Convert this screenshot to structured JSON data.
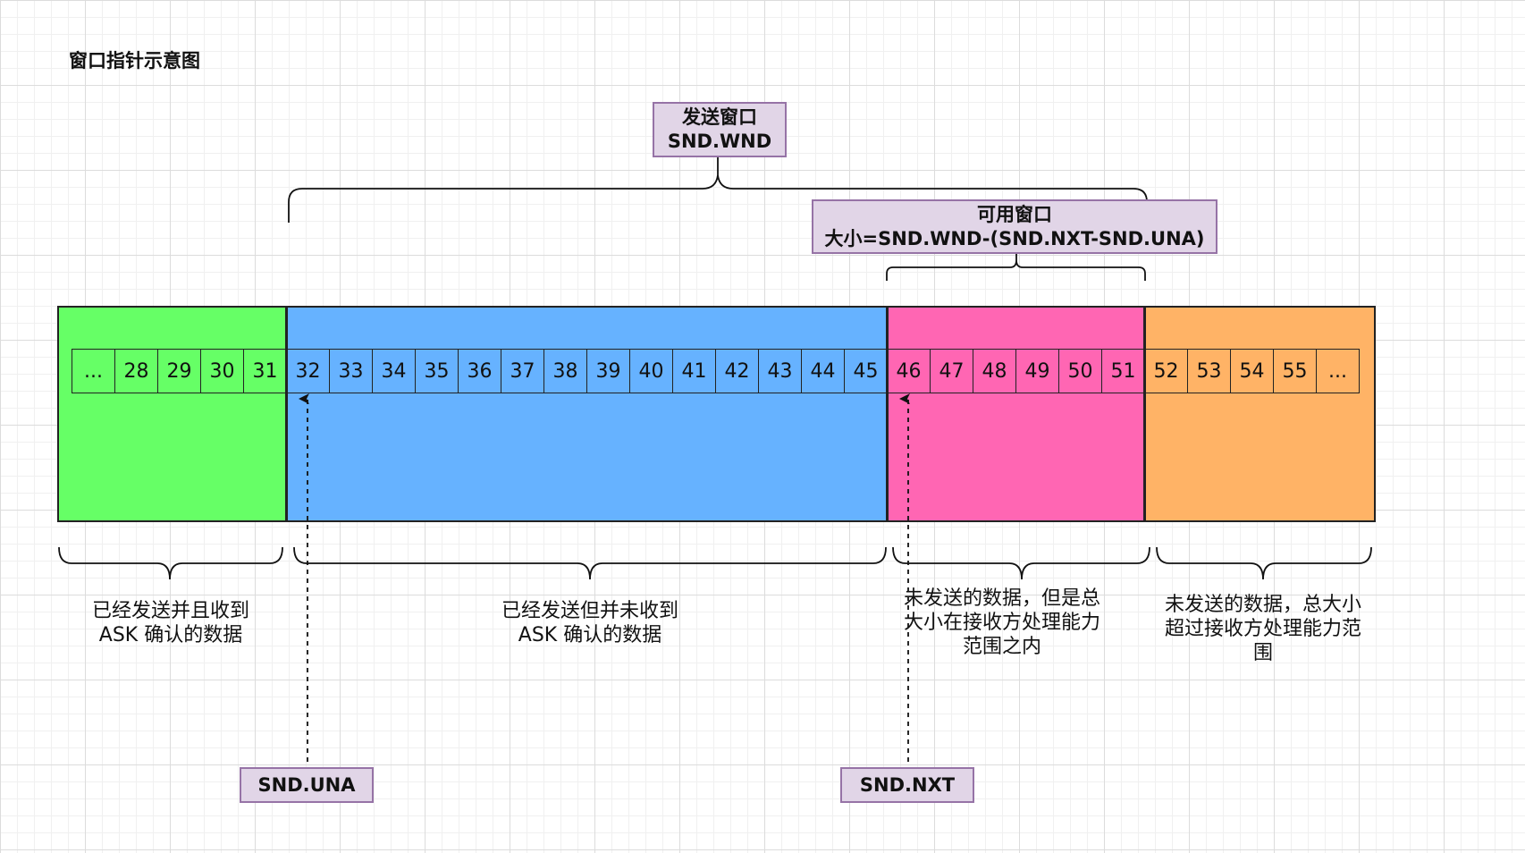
{
  "title": "窗口指针示意图",
  "send_window": {
    "line1": "发送窗口",
    "line2": "SND.WND"
  },
  "usable_window": {
    "line1": "可用窗口",
    "line2": "大小=SND.WND-(SND.NXT-SND.UNA)"
  },
  "cells": [
    "...",
    "28",
    "29",
    "30",
    "31",
    "32",
    "33",
    "34",
    "35",
    "36",
    "37",
    "38",
    "39",
    "40",
    "41",
    "42",
    "43",
    "44",
    "45",
    "46",
    "47",
    "48",
    "49",
    "50",
    "51",
    "52",
    "53",
    "54",
    "55",
    "..."
  ],
  "zones": [
    {
      "name": "acked",
      "color": "#66ff66",
      "from_cell": 0,
      "to_cell": 4
    },
    {
      "name": "sent-unacked",
      "color": "#66b2ff",
      "from_cell": 5,
      "to_cell": 18
    },
    {
      "name": "usable",
      "color": "#ff66b3",
      "from_cell": 19,
      "to_cell": 24
    },
    {
      "name": "outside-window",
      "color": "#ffb366",
      "from_cell": 25,
      "to_cell": 29
    }
  ],
  "descriptions": {
    "acked": {
      "line1": "已经发送并且收到",
      "line2": "ASK 确认的数据"
    },
    "unacked": {
      "line1": "已经发送但并未收到",
      "line2": "ASK 确认的数据"
    },
    "usable": {
      "line1": "未发送的数据，但是总",
      "line2": "大小在接收方处理能力",
      "line3": "范围之内"
    },
    "outside": {
      "line1": "未发送的数据，总大小",
      "line2": "超过接收方处理能力范",
      "line3": "围"
    }
  },
  "pointers": {
    "una": "SND.UNA",
    "nxt": "SND.NXT"
  },
  "colors": {
    "label_fill": "#e1d5e7",
    "label_border": "#9673a6"
  }
}
